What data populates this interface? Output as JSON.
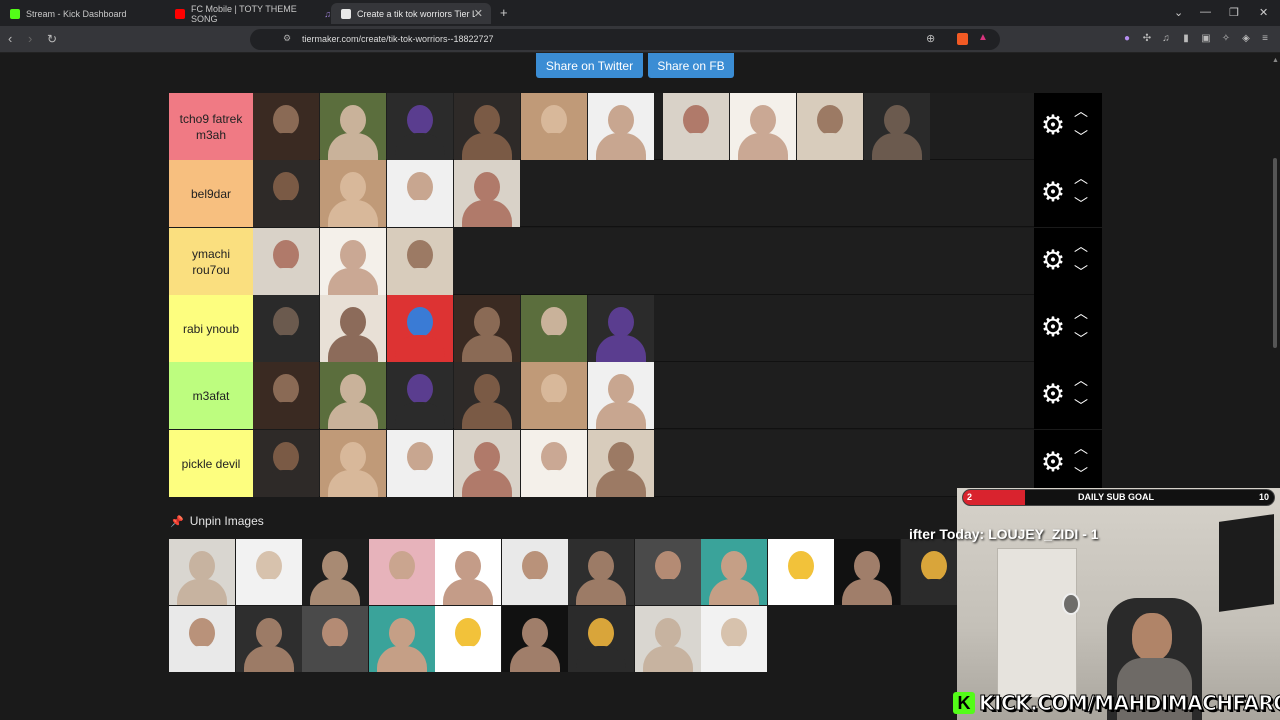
{
  "browser": {
    "tabs": [
      {
        "label": "Stream - Kick Dashboard",
        "favicon_color": "#53fc18"
      },
      {
        "label": "FC Mobile | TOTY THEME SONG",
        "favicon_color": "#ff0000"
      },
      {
        "label": "Create a tik tok worriors Tier List",
        "favicon_color": "#e8e8e8",
        "active": true
      }
    ],
    "url": "tiermaker.com/create/tik-tok-worriors--18822727"
  },
  "share": {
    "twitter": "Share on Twitter",
    "facebook": "Share on FB"
  },
  "tiers": [
    {
      "label": "tcho9 fatrek m3ah",
      "color": "#f07a84",
      "image_count": 10
    },
    {
      "label": "bel9dar",
      "color": "#f7bf7f",
      "image_count": 4
    },
    {
      "label": "ymachi rou7ou",
      "color": "#fadf7f",
      "image_count": 3
    },
    {
      "label": "rabi ynoub",
      "color": "#fdfe7f",
      "image_count": 6
    },
    {
      "label": "m3afat",
      "color": "#bdfd7f",
      "image_count": 6
    },
    {
      "label": "pickle devil",
      "color": "#fdfe7f",
      "image_count": 6
    }
  ],
  "pool": {
    "unpin_label": "Unpin Images",
    "row1_count": 12,
    "row2_count": 9
  },
  "overlay": {
    "goal_label": "DAILY SUB GOAL",
    "goal_current": "2",
    "goal_target": "10",
    "goal_progress": 0.2,
    "gifter_text": "ifter Today: LOUJEY_ZIDI - 1",
    "kick_url": "KICK.COM/MAHDIMACHFAROTB"
  }
}
